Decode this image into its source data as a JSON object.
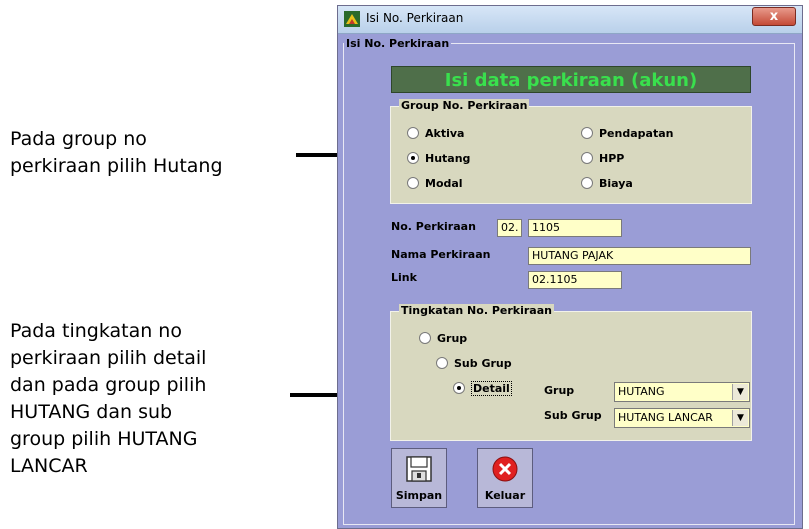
{
  "annotations": {
    "note1": [
      "Pada group no",
      "perkiraan pilih Hutang"
    ],
    "note2": [
      "Pada tingkatan no",
      "perkiraan pilih detail",
      "dan pada group pilih",
      "HUTANG dan sub",
      "group pilih HUTANG",
      "LANCAR"
    ]
  },
  "window": {
    "title": "Isi No. Perkiraan",
    "close_label": "x",
    "frame_legend": "Isi No. Perkiraan",
    "header": "Isi data perkiraan (akun)"
  },
  "group_panel": {
    "legend": "Group No. Perkiraan",
    "options": [
      "Aktiva",
      "Hutang",
      "Modal",
      "Pendapatan",
      "HPP",
      "Biaya"
    ],
    "selected": "Hutang"
  },
  "fields": {
    "no_perkiraan_label": "No. Perkiraan",
    "no_prefix": "02.",
    "no_value": "1105",
    "nama_label": "Nama Perkiraan",
    "nama_value": "HUTANG PAJAK",
    "link_label": "Link",
    "link_value": "02.1105"
  },
  "level_panel": {
    "legend": "Tingkatan No. Perkiraan",
    "options": [
      "Grup",
      "Sub Grup",
      "Detail"
    ],
    "selected": "Detail",
    "grup_label": "Grup",
    "grup_value": "HUTANG",
    "subgrup_label": "Sub Grup",
    "subgrup_value": "HUTANG LANCAR"
  },
  "buttons": {
    "save": "Simpan",
    "exit": "Keluar"
  },
  "colors": {
    "window_bg": "#9a9dd6",
    "panel_bg": "#d8d8bf",
    "header_bg": "#4f6f4a",
    "header_text": "#39e04d",
    "field_bg": "#ffffc8"
  },
  "icons": [
    "app-icon",
    "floppy-disk-icon",
    "close-x-icon",
    "chevron-down-icon"
  ]
}
